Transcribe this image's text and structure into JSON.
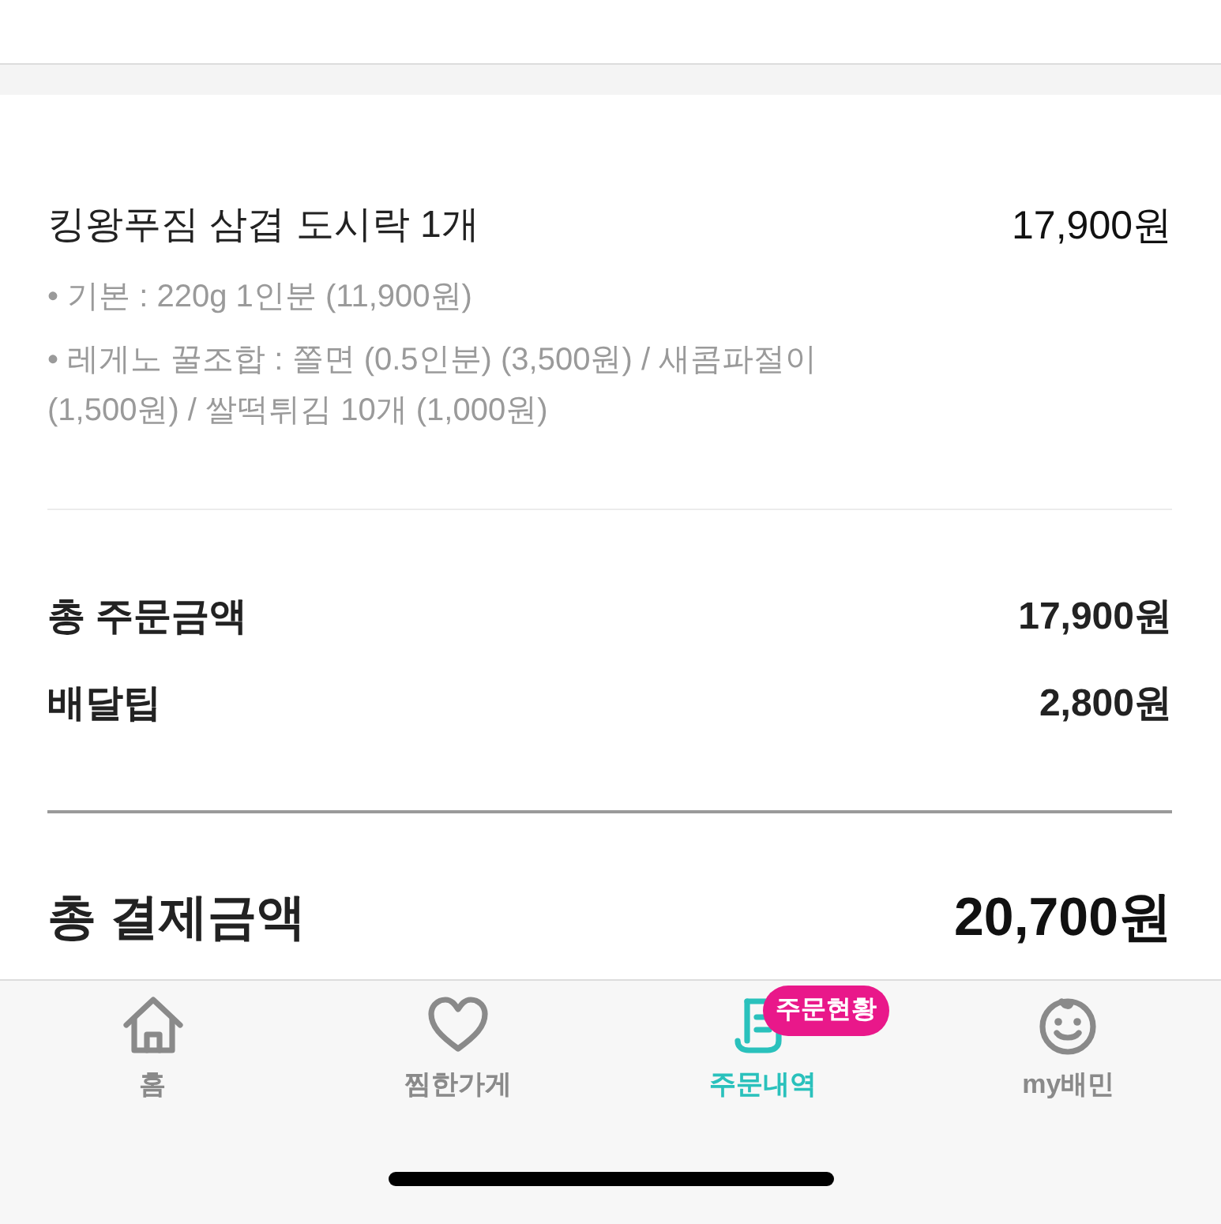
{
  "order_item": {
    "name": "킹왕푸짐 삼겹 도시락 1개",
    "price": "17,900원",
    "options": [
      "• 기본 : 220g 1인분 (11,900원)",
      "• 레게노 꿀조합 : 쫄면 (0.5인분) (3,500원) / 새콤파절이 (1,500원) / 쌀떡튀김 10개 (1,000원)"
    ]
  },
  "summary": [
    {
      "label": "총 주문금액",
      "value": "17,900원"
    },
    {
      "label": "배달팁",
      "value": "2,800원"
    }
  ],
  "total": {
    "label": "총 결제금액",
    "value": "20,700원"
  },
  "tab_bar": [
    {
      "kind": "home",
      "label": "홈",
      "selected": false
    },
    {
      "kind": "heart",
      "label": "찜한가게",
      "selected": false
    },
    {
      "kind": "receipt",
      "label": "주문내역",
      "selected": true,
      "badge": "주문현황"
    },
    {
      "kind": "smiley",
      "label": "my배민",
      "selected": false
    }
  ]
}
